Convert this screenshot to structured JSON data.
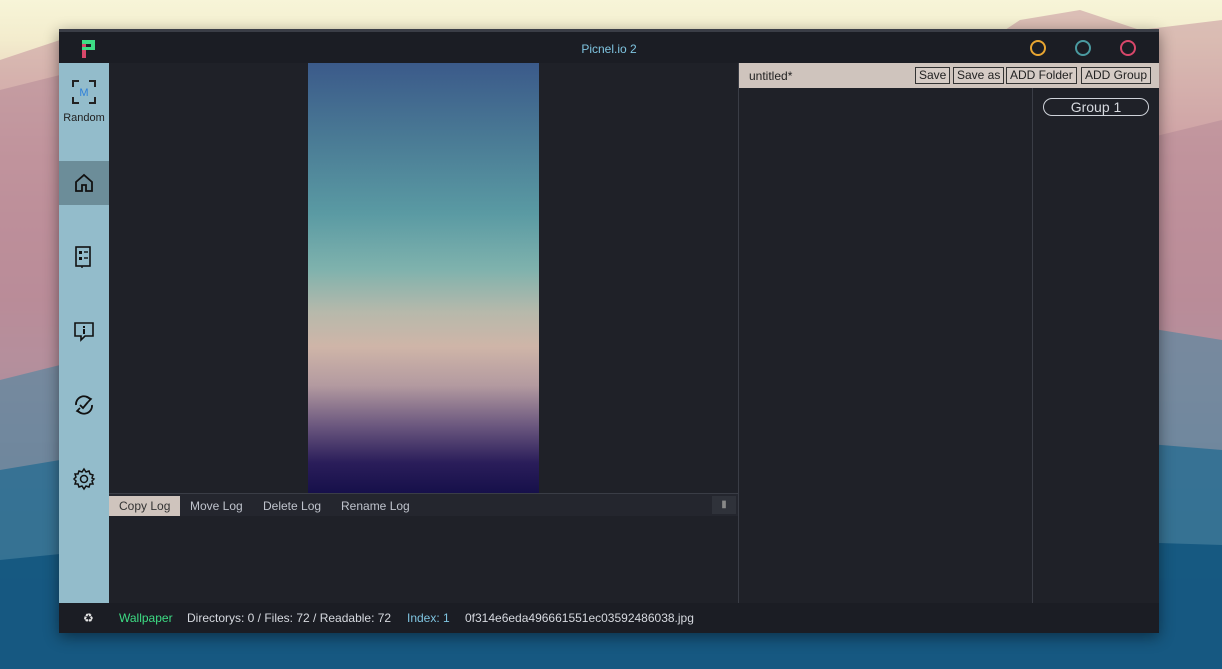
{
  "window": {
    "title": "Picnel.io 2"
  },
  "window_controls": {
    "colors": [
      "#e8a531",
      "#4a9aa0",
      "#d8476a"
    ]
  },
  "sidebar": {
    "random_label": "Random",
    "items": [
      {
        "icon": "home-icon",
        "active": true
      },
      {
        "icon": "file-list-icon",
        "active": false
      },
      {
        "icon": "info-bubble-icon",
        "active": false
      },
      {
        "icon": "sync-check-icon",
        "active": false
      },
      {
        "icon": "gear-icon",
        "active": false
      }
    ]
  },
  "log": {
    "tabs": [
      "Copy Log",
      "Move Log",
      "Delete Log",
      "Rename Log"
    ],
    "active_tab": "Copy Log"
  },
  "right_panel": {
    "file_name": "untitled*",
    "buttons": {
      "save": "Save",
      "save_as": "Save as",
      "add_folder": "ADD Folder",
      "add_group": "ADD Group"
    },
    "groups": [
      "Group 1"
    ]
  },
  "status": {
    "folder": "Wallpaper",
    "counts": "Directorys: 0 / Files: 72 / Readable: 72",
    "index": "Index: 1",
    "filename": "0f314e6eda496661551ec03592486038.jpg"
  },
  "colors": {
    "accent_green": "#3ddc84",
    "index_blue": "#7fc4e0",
    "sidebar": "#93bccb"
  }
}
